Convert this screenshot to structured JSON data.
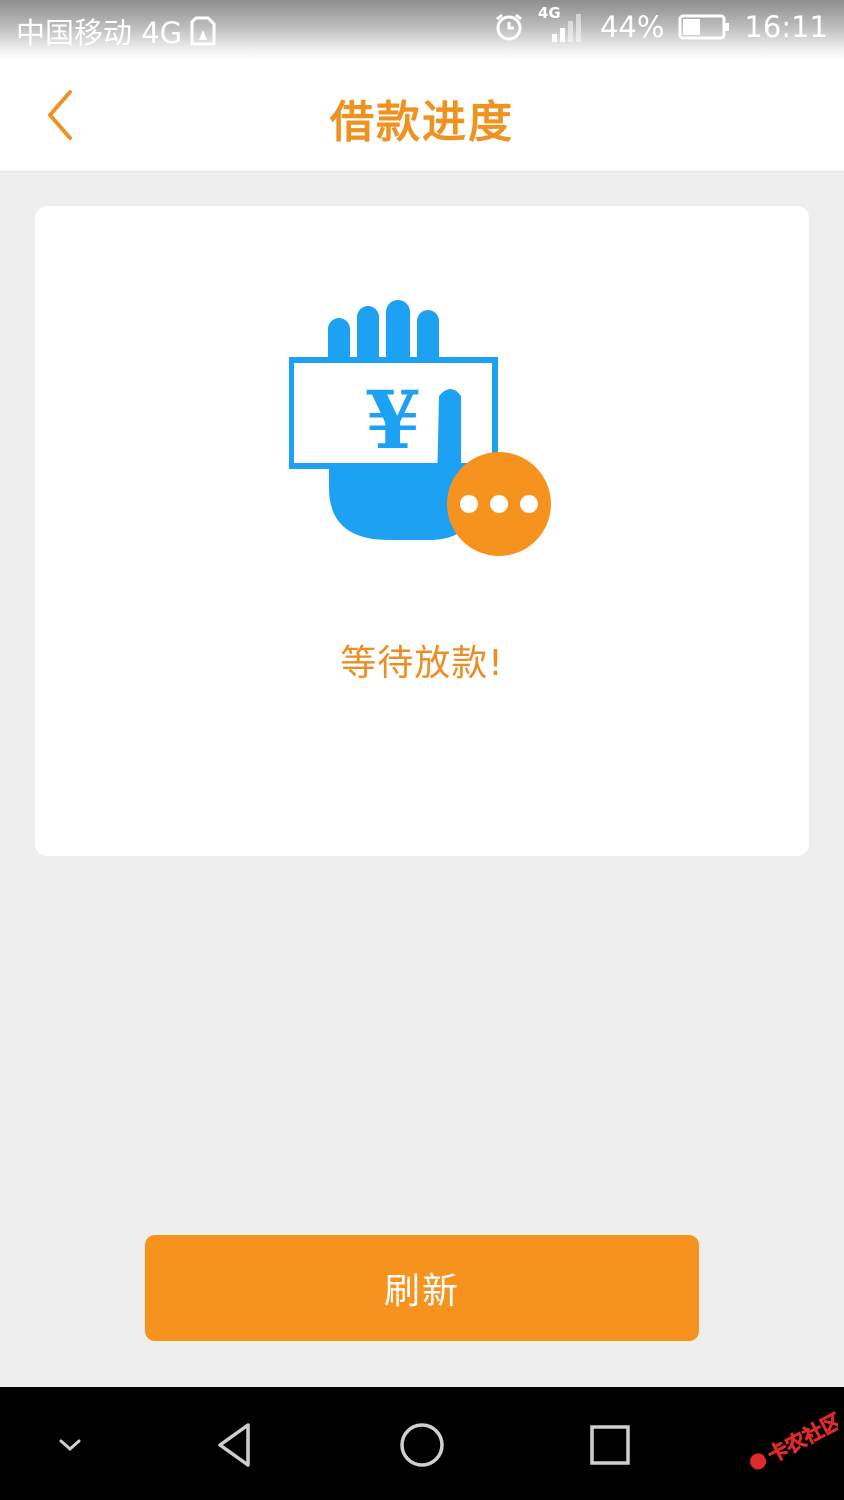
{
  "status_bar": {
    "carrier": "中国移动 4G",
    "network_badge": "4G",
    "battery": "44%",
    "time": "16:11",
    "icons": [
      "sim-card-icon",
      "alarm-icon",
      "signal-icon",
      "battery-icon"
    ]
  },
  "header": {
    "title": "借款进度",
    "back_icon": "chevron-left-icon"
  },
  "card": {
    "illustration_icon": "hand-money-waiting-icon",
    "currency_symbol": "¥",
    "message": "等待放款!"
  },
  "actions": {
    "refresh_label": "刷新"
  },
  "nav_bar": {
    "icons": [
      "chevron-down-icon",
      "back-triangle-icon",
      "home-circle-icon",
      "recents-square-icon"
    ]
  },
  "watermark": {
    "text": "卡农社区"
  },
  "colors": {
    "accent": "#f5931e",
    "title": "#ef9320",
    "illustration_blue": "#1da1f2",
    "illustration_orange": "#f5931e",
    "background": "#eeeeee"
  }
}
